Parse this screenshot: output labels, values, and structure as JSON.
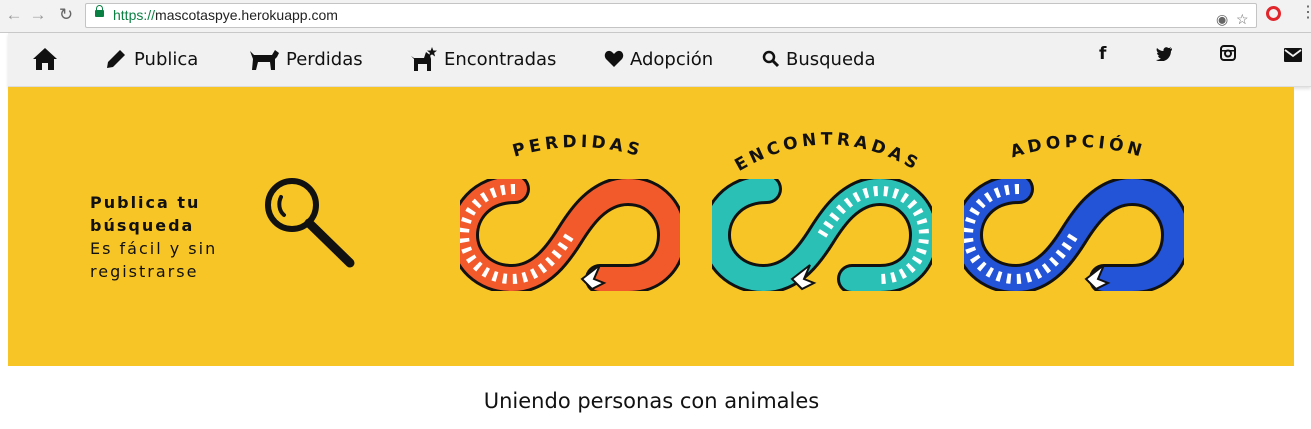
{
  "browser": {
    "url_protocol": "https://",
    "url_host": "mascotaspye.herokuapp.com"
  },
  "nav": {
    "items": [
      {
        "label": "Publica",
        "icon": "pencil-icon"
      },
      {
        "label": "Perdidas",
        "icon": "dog-icon"
      },
      {
        "label": "Encontradas",
        "icon": "dog-star-icon"
      },
      {
        "label": "Adopción",
        "icon": "heart-icon"
      },
      {
        "label": "Busqueda",
        "icon": "search-icon"
      }
    ],
    "home_icon": "home-icon",
    "social": [
      {
        "name": "facebook-icon",
        "glyph": "f"
      },
      {
        "name": "twitter-icon",
        "glyph": "t"
      },
      {
        "name": "instagram-icon",
        "glyph": "ig"
      },
      {
        "name": "mail-icon",
        "glyph": "mail"
      }
    ]
  },
  "banner": {
    "tagline_bold_1": "Publica tu",
    "tagline_bold_2": "búsqueda",
    "tagline_line_3": "Es fácil y sin",
    "tagline_line_4": "registrarse",
    "categories": [
      {
        "label": "PERDIDAS",
        "color": "#f25a2b"
      },
      {
        "label": "ENCONTRADAS",
        "color": "#2ac0b6"
      },
      {
        "label": "ADOPCIÓN",
        "color": "#2353d6"
      }
    ],
    "background": "#f7c526"
  },
  "subtitle": "Uniendo personas con animales"
}
